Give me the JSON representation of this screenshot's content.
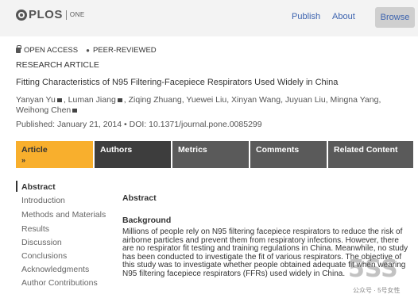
{
  "header": {
    "logo_text": "PLOS",
    "logo_sub": "ONE",
    "nav": {
      "publish": "Publish",
      "about": "About",
      "browse": "Browse"
    }
  },
  "badges": {
    "open_access": "OPEN ACCESS",
    "peer_reviewed": "PEER-REVIEWED"
  },
  "article": {
    "type": "RESEARCH ARTICLE",
    "title": "Fitting Characteristics of N95 Filtering-Facepiece Respirators Used Widely in China",
    "authors_line1_a": "Yanyan Yu",
    "authors_line1_b": ", Luman Jiang",
    "authors_line1_c": ", Ziqing Zhuang, Yuewei Liu, Xinyan Wang, Juyuan Liu, Mingna Yang,",
    "authors_line2": "Weihong Chen",
    "published": "Published: January 21, 2014",
    "doi": "DOI: 10.1371/journal.pone.0085299"
  },
  "tabs": {
    "article": "Article",
    "article_chevron": "»",
    "authors": "Authors",
    "metrics": "Metrics",
    "comments": "Comments",
    "related": "Related Content"
  },
  "sidebar": {
    "items": [
      "Abstract",
      "Introduction",
      "Methods and Materials",
      "Results",
      "Discussion",
      "Conclusions",
      "Acknowledgments",
      "Author Contributions"
    ]
  },
  "main": {
    "abstract_heading": "Abstract",
    "background_heading": "Background",
    "background_text": "Millions of people rely on N95 filtering facepiece respirators to reduce the risk of airborne particles and prevent them from respiratory infections. However, there are no respirator fit testing and training regulations in China. Meanwhile, no study has been conducted to investigate the fit of various respirators. The objective of this study was to investigate whether people obtained adequate fit when wearing N95 filtering facepiece respirators (FFRs) used widely in China."
  },
  "watermark": {
    "mark": "5SS",
    "text": "公众号 · 5号女性"
  },
  "icons": {
    "lock": "lock-icon",
    "star": "star-icon",
    "mail": "mail-icon",
    "logo": "plos-logo-icon"
  }
}
